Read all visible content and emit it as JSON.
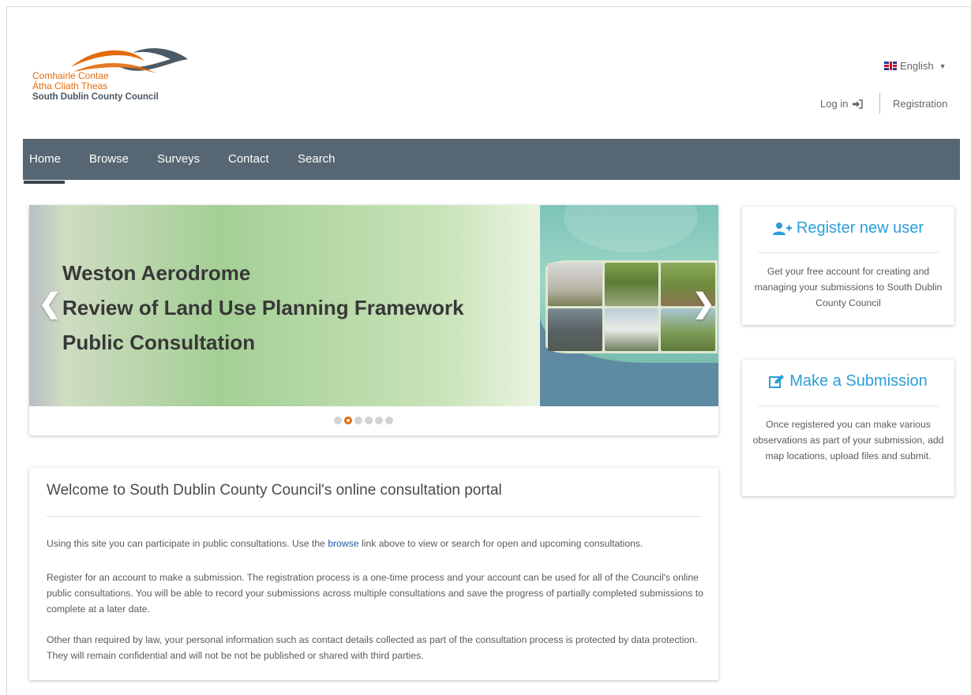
{
  "header": {
    "logo": {
      "line1": "Comhairle Contae",
      "line2": "Átha Cliath Theas",
      "line3": "South Dublin County Council",
      "colors": {
        "orange": "#e46c0a",
        "slate": "#4a5560"
      }
    },
    "language": {
      "label": "English",
      "flag_icon": "uk-flag-icon"
    },
    "login_label": "Log in",
    "registration_label": "Registration"
  },
  "nav": {
    "background": "#566773",
    "items": [
      {
        "label": "Home",
        "active": true
      },
      {
        "label": "Browse"
      },
      {
        "label": "Surveys"
      },
      {
        "label": "Contact"
      },
      {
        "label": "Search"
      }
    ]
  },
  "carousel": {
    "title_lines": [
      "Weston Aerodrome",
      "Review of Land Use Planning Framework",
      "Public Consultation"
    ],
    "slide_count": 6,
    "active_index": 1,
    "accent": "#e46c0a"
  },
  "welcome": {
    "title": "Welcome to South Dublin County Council's online consultation portal",
    "p1_before": "Using this site you can participate in public consultations. Use the ",
    "p1_link": "browse",
    "p1_after": " link above to view or search for open and upcoming consultations.",
    "p2": "Register for an account to make a submission. The registration process is a one-time process and your account can be used for all of the Council's online public consultations. You will be able to record your submissions across multiple consultations and save the progress of partially completed submissions to complete at a later date.",
    "p3": "Other than required by law, your personal information such as contact details collected as part of the consultation process is protected by data protection. They will remain confidential and will not be not be published or shared with third parties."
  },
  "sidebar": {
    "register": {
      "title": "Register new user",
      "icon": "user-plus-icon",
      "body": "Get your free account for creating and managing your submissions to South Dublin County Council"
    },
    "submission": {
      "title": "Make a Submission",
      "icon": "edit-icon",
      "body": "Once registered you can make various observations as part of your submission, add map locations, upload files and submit."
    },
    "link_color": "#2a9ed9"
  }
}
